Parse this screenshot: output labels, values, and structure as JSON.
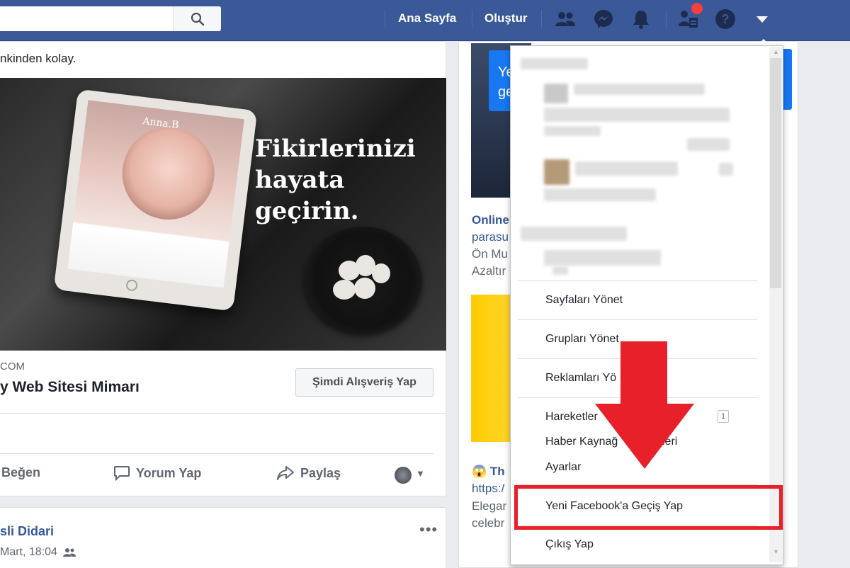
{
  "topbar": {
    "nav": [
      {
        "label": "Ana Sayfa"
      },
      {
        "label": "Oluştur"
      }
    ],
    "icons": [
      "friends-icon",
      "messenger-icon",
      "bell-icon",
      "friend-requests-icon",
      "help-icon",
      "caret-down-icon"
    ],
    "brand_color": "#3b5998"
  },
  "feed": {
    "post": {
      "text_fragment": "nkinden kolay.",
      "ad_headline_line1": "Fikirlerinizi",
      "ad_headline_line2": "hayata geçirin.",
      "tablet_title": "Anna.B",
      "ad_domain": "COM",
      "ad_name": "y Web Sitesi Mimarı",
      "cta_label": "Şimdi Alışveriş Yap",
      "actions": {
        "like": "Beğen",
        "comment": "Yorum Yap",
        "share": "Paylaş"
      }
    },
    "post2": {
      "author": "sli Didari",
      "date": "Mart, 18:04"
    }
  },
  "right_column": {
    "blue_box_line1": "Yen",
    "blue_box_line2": "geç",
    "ad1_title": "Online",
    "ad1_sub": "parasu",
    "ad1_line3": "Ön Mu",
    "ad1_line4": "Azaltır",
    "ad2_title": "😱 Th",
    "ad2_link": "https:/",
    "ad2_line3": "Elegar",
    "ad2_line4": "celebr"
  },
  "dropdown": {
    "items": [
      {
        "label": "Sayfaları Yönet"
      },
      {
        "label": "Grupları Yönet"
      },
      {
        "label": "Reklamları Yö"
      },
      {
        "label": "Hareketler",
        "badge": "1"
      },
      {
        "label": "Haber Kaynağ"
      },
      {
        "label": "Ayarlar"
      },
      {
        "label": "Yeni Facebook'a Geçiş Yap"
      },
      {
        "label": "Çıkış Yap"
      }
    ],
    "haber_suffix": "leri",
    "highlight_color": "#e8202a"
  }
}
